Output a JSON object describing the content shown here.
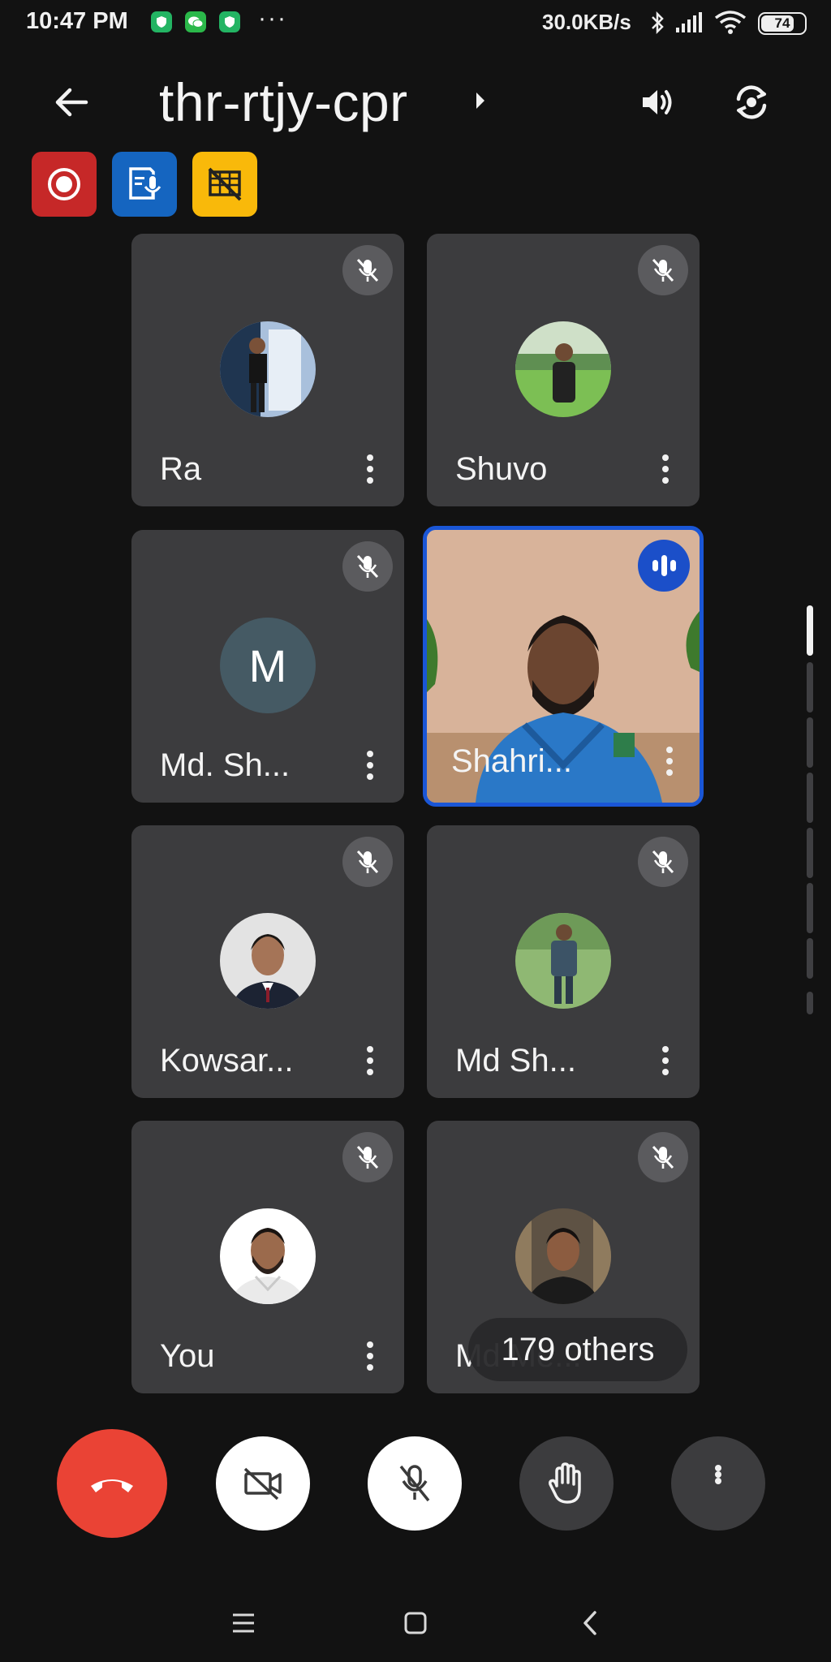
{
  "status_bar": {
    "time": "10:47 PM",
    "more": "···",
    "network_speed": "30.0KB/s",
    "battery": "74"
  },
  "header": {
    "meeting_code": "thr-rtjy-cpr",
    "icons": [
      "back-arrow-icon",
      "chevron-right-icon",
      "speaker-icon",
      "switch-camera-icon"
    ]
  },
  "indicators": [
    {
      "name": "recording",
      "color": "#c62828"
    },
    {
      "name": "transcription",
      "color": "#1565c0"
    },
    {
      "name": "no-screen",
      "color": "#f9b90a"
    }
  ],
  "participants": [
    {
      "name": "Ra",
      "muted": true
    },
    {
      "name": "Shuvo",
      "muted": true
    },
    {
      "name": "Md. Sh...",
      "initial": "M",
      "muted": true
    },
    {
      "name": "Shahri...",
      "speaking": true
    },
    {
      "name": "Kowsar...",
      "muted": true
    },
    {
      "name": "Md Sh...",
      "muted": true
    },
    {
      "name": "You",
      "muted": true
    },
    {
      "name": "Md Me...",
      "muted": true
    }
  ],
  "others_count": "179 others",
  "controls": [
    "end-call",
    "camera-off",
    "mic-off",
    "raise-hand",
    "more-options"
  ],
  "colors": {
    "end_call": "#ea4335",
    "speaking_border": "#1a56d6",
    "tile_bg": "#3c3c3e"
  }
}
